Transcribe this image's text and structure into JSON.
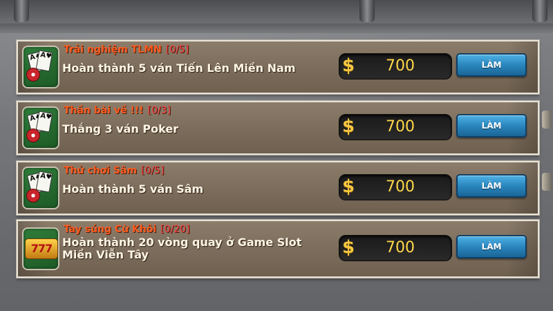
{
  "quests": [
    {
      "icon": "cards-chips-icon",
      "title": "Trải nghiệm TLMN",
      "progress": "[0/5]",
      "description": "Hoàn thành 5 ván Tiến Lên Miền Nam",
      "reward": "700",
      "button": "LÀM"
    },
    {
      "icon": "cards-chips-icon",
      "title": "Thần bài về !!!",
      "progress": "[0/3]",
      "description": "Thắng 3 ván Poker",
      "reward": "700",
      "button": "LÀM"
    },
    {
      "icon": "cards-chips-icon",
      "title": "Thử chơi Sâm",
      "progress": "[0/5]",
      "description": "Hoàn thành 5 ván Sâm",
      "reward": "700",
      "button": "LÀM"
    },
    {
      "icon": "slot-777-icon",
      "title": "Tay súng Cừ Khôi",
      "progress": "[0/20]",
      "description": "Hoàn thành 20 vòng quay ở Game Slot Miền Viễn Tây",
      "reward": "700",
      "button": "LÀM"
    }
  ],
  "currency_symbol": "$",
  "card_glyphs": {
    "a": "A♠",
    "b": "A♥"
  },
  "slot_glyph": "777",
  "colors": {
    "title": "#ff5a1e",
    "progress": "#ff3b3b",
    "reward_text": "#ffd84a",
    "button": "#2a86bd"
  }
}
